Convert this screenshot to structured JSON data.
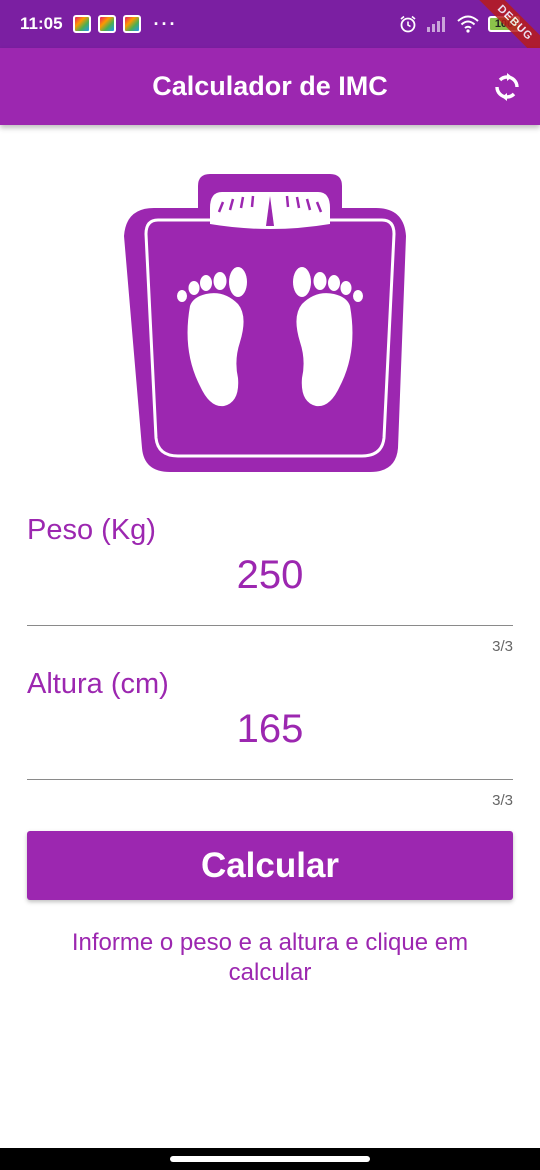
{
  "status_bar": {
    "time": "11:05",
    "more": "···",
    "battery": "100"
  },
  "debug_banner": "DEBUG",
  "app_bar": {
    "title": "Calculador de IMC",
    "refresh_icon": "refresh-icon"
  },
  "image": {
    "icon": "scale-icon",
    "color": "#9c27b0"
  },
  "weight_field": {
    "label": "Peso (Kg)",
    "value": "250",
    "counter": "3/3"
  },
  "height_field": {
    "label": "Altura (cm)",
    "value": "165",
    "counter": "3/3"
  },
  "calculate_button": {
    "label": "Calcular"
  },
  "info_text": "Informe o peso e a altura e clique em calcular",
  "colors": {
    "primary": "#9c27b0",
    "status_bar": "#7b1fa2"
  }
}
